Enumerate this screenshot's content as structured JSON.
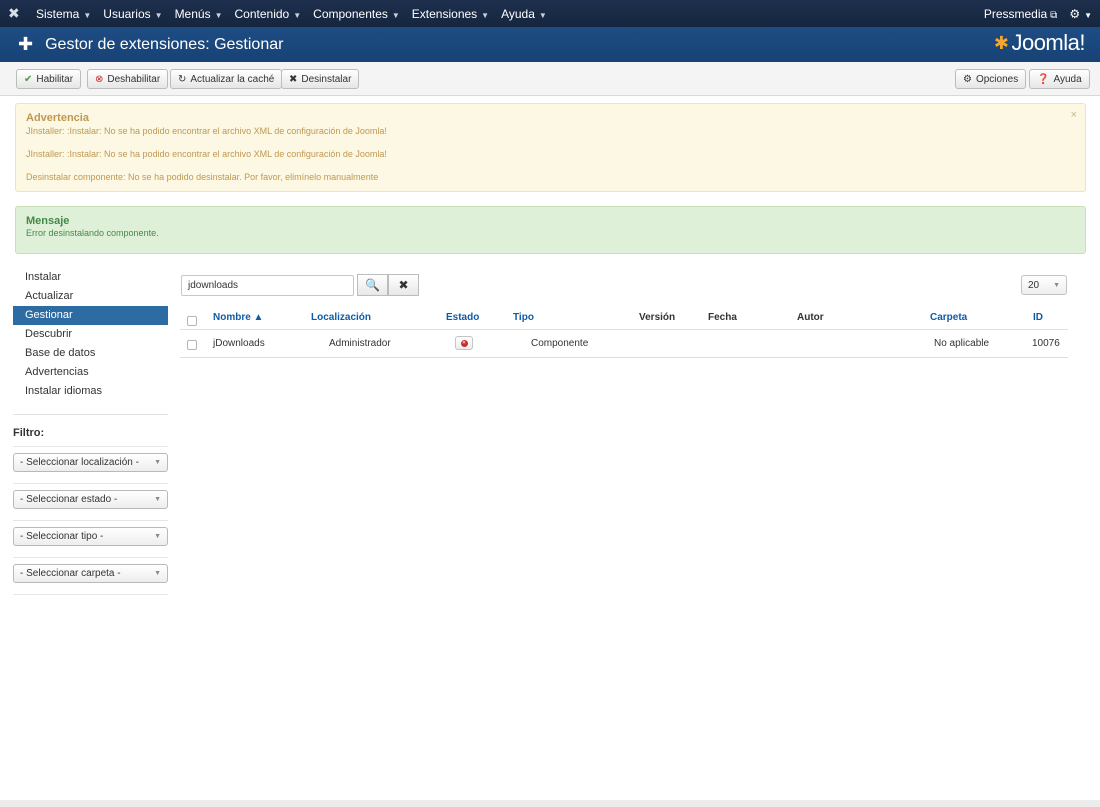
{
  "topnav": {
    "menu": [
      "Sistema",
      "Usuarios",
      "Menús",
      "Contenido",
      "Componentes",
      "Extensiones",
      "Ayuda"
    ],
    "site_link": "Pressmedia"
  },
  "titlebar": {
    "title": "Gestor de extensiones: Gestionar",
    "logo_text": "Joomla!"
  },
  "toolbar": {
    "enable": "Habilitar",
    "disable": "Deshabilitar",
    "refresh_cache": "Actualizar la caché",
    "uninstall": "Desinstalar",
    "options": "Opciones",
    "help": "Ayuda"
  },
  "warning": {
    "title": "Advertencia",
    "lines": [
      "JInstaller: :Instalar: No se ha podido encontrar el archivo XML de configuración de Joomla!",
      "JInstaller: :Instalar: No se ha podido encontrar el archivo XML de configuración de Joomla!",
      "Desinstalar componente: No se ha podido desinstalar. Por favor, elimínelo manualmente"
    ],
    "close": "×"
  },
  "message": {
    "title": "Mensaje",
    "text": "Error desinstalando componente."
  },
  "sidebar": {
    "items": [
      {
        "label": "Instalar"
      },
      {
        "label": "Actualizar"
      },
      {
        "label": "Gestionar"
      },
      {
        "label": "Descubrir"
      },
      {
        "label": "Base de datos"
      },
      {
        "label": "Advertencias"
      },
      {
        "label": "Instalar idiomas"
      }
    ],
    "active": "Gestionar"
  },
  "filters": {
    "title": "Filtro:",
    "location": "- Seleccionar localización -",
    "state": "- Seleccionar estado -",
    "type": "- Seleccionar tipo -",
    "folder": "- Seleccionar carpeta -"
  },
  "search": {
    "value": "jdownloads"
  },
  "limit": {
    "value": "20"
  },
  "table": {
    "headers": {
      "name": "Nombre ▲",
      "location": "Localización",
      "state": "Estado",
      "type": "Tipo",
      "version": "Versión",
      "date": "Fecha",
      "author": "Autor",
      "folder": "Carpeta",
      "id": "ID"
    },
    "rows": [
      {
        "name": "jDownloads",
        "location": "Administrador",
        "type": "Componente",
        "folder": "No aplicable",
        "id": "10076"
      }
    ]
  },
  "colors": {
    "topnav": "#1d2f4d",
    "titlebar": "#1e4d83",
    "active_sidebar": "#2d6ca2",
    "link": "#0f5ba7",
    "warning_bg": "#fcf8e3",
    "success_bg": "#dff0d8"
  }
}
